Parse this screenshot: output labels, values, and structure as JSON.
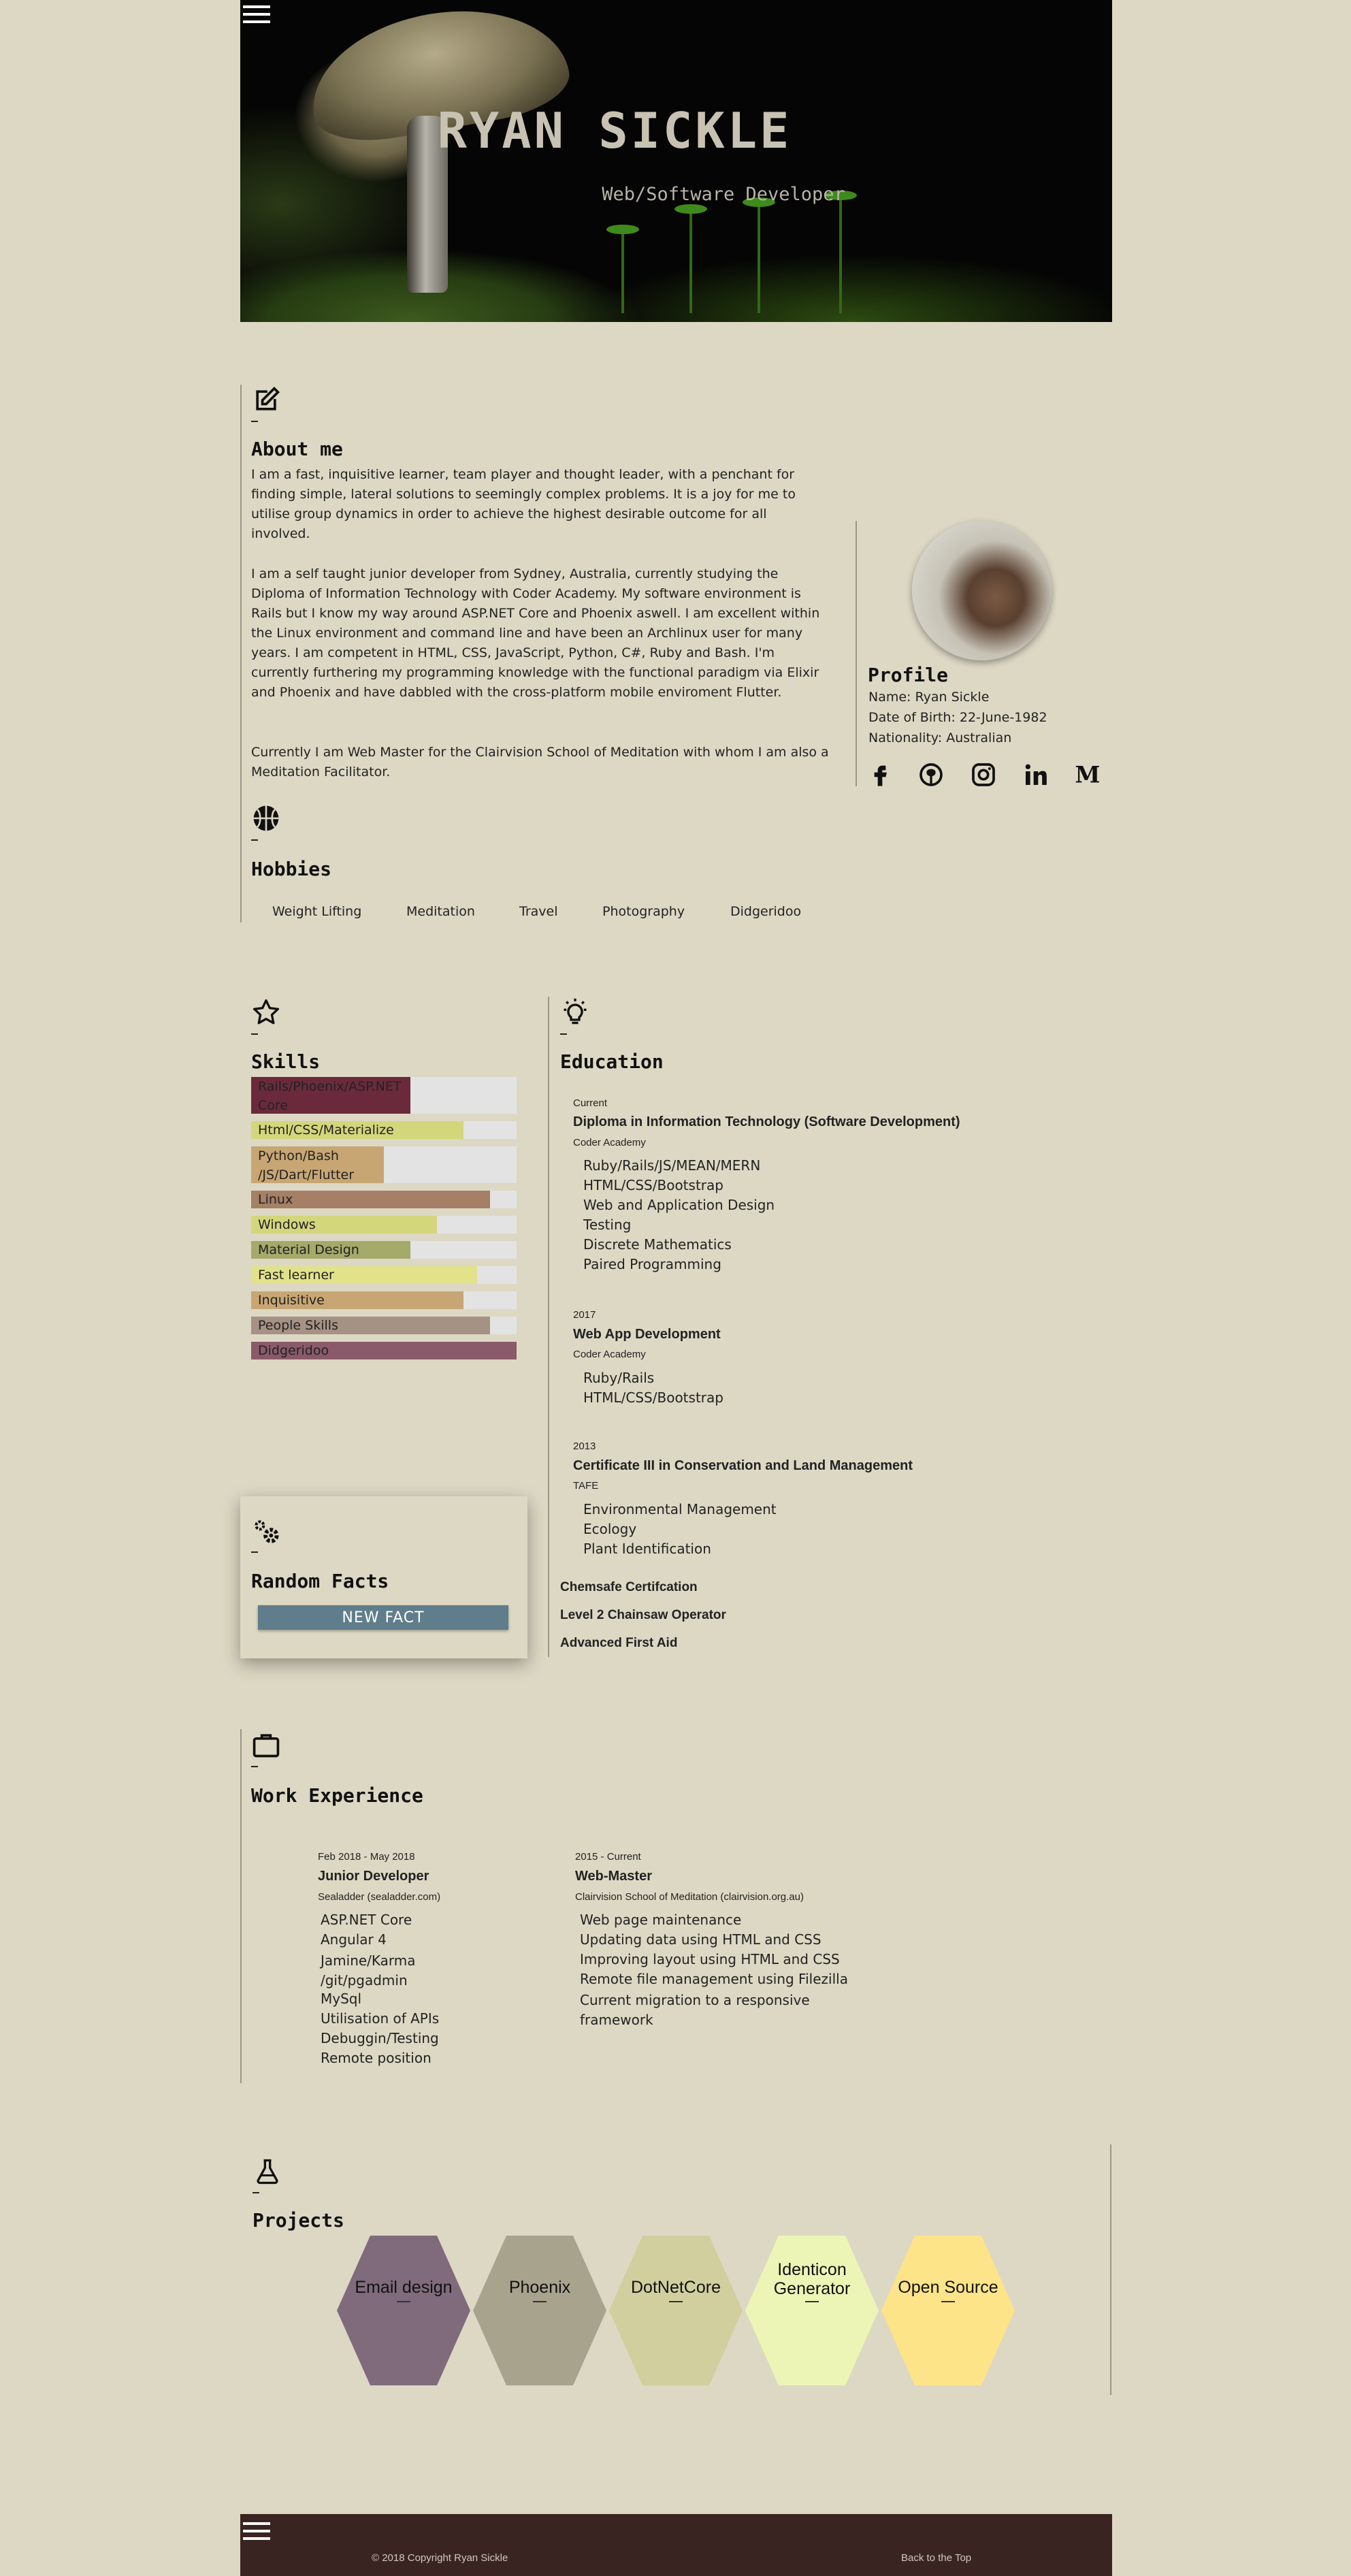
{
  "header": {
    "name": "RYAN SICKLE",
    "subtitle": "Web/Software Developer",
    "menu_icon": "hamburger-menu-icon"
  },
  "about": {
    "icon": "edit-note-icon",
    "title": "About me",
    "paragraphs": [
      "I am a fast, inquisitive learner, team player and thought leader, with a penchant for finding simple, lateral solutions to seemingly complex problems. It is a joy for me to utilise group dynamics in order to achieve the highest desirable outcome for all involved.",
      "I am a self taught junior developer from Sydney, Australia, currently studying the Diploma of Information Technology with Coder Academy. My software environment is Rails but I know my way around ASP.NET Core and Phoenix aswell. I am excellent within the Linux environment and command line and have been an Archlinux user for many years. I am competent in HTML, CSS, JavaScript, Python, C#, Ruby and Bash. I'm currently furthering my programming knowledge with the functional paradigm via Elixir and Phoenix and have dabbled with the cross-platform mobile enviroment Flutter.",
      "Currently I am Web Master for the Clairvision School of Meditation with whom I am also a Meditation Facilitator."
    ]
  },
  "profile": {
    "title": "Profile",
    "name": "Name: Ryan Sickle",
    "dob": "Date of Birth: 22-June-1982",
    "nationality": "Nationality: Australian",
    "social_icons": [
      "facebook-icon",
      "github-icon",
      "instagram-icon",
      "linkedin-icon",
      "medium-icon"
    ]
  },
  "hobbies": {
    "icon": "basketball-icon",
    "title": "Hobbies",
    "items": [
      "Weight Lifting",
      "Meditation",
      "Travel",
      "Photography",
      "Didgeridoo"
    ]
  },
  "skills": {
    "icon": "star-icon",
    "title": "Skills",
    "items": [
      {
        "label": "Rails/Phoenix/ASP.NET Core",
        "level": 0.6,
        "color": "#6b2a3c"
      },
      {
        "label": "Html/CSS/Materialize",
        "level": 0.8,
        "color": "#d4d67c"
      },
      {
        "label": "Python/Bash /JS/Dart/Flutter",
        "level": 0.5,
        "color": "#c8a673"
      },
      {
        "label": "Linux",
        "level": 0.9,
        "color": "#a57f66"
      },
      {
        "label": "Windows",
        "level": 0.7,
        "color": "#d4d67c"
      },
      {
        "label": "Material Design",
        "level": 0.6,
        "color": "#a5a96a"
      },
      {
        "label": "Fast learner",
        "level": 0.85,
        "color": "#e1e28a"
      },
      {
        "label": "Inquisitive",
        "level": 0.8,
        "color": "#c8a673"
      },
      {
        "label": "People Skills",
        "level": 0.9,
        "color": "#a69185"
      },
      {
        "label": "Didgeridoo",
        "level": 1.0,
        "color": "#8a5a6a"
      }
    ]
  },
  "random_facts": {
    "icon": "gears-icon",
    "title": "Random Facts",
    "button": "NEW FACT"
  },
  "education": {
    "icon": "lightbulb-icon",
    "title": "Education",
    "entries": [
      {
        "period": "Current",
        "title": "Diploma in Information Technology (Software Development)",
        "provider": "Coder Academy",
        "items": [
          "Ruby/Rails/JS/MEAN/MERN",
          "HTML/CSS/Bootstrap",
          "Web and Application Design",
          "Testing",
          "Discrete Mathematics",
          "Paired Programming"
        ]
      },
      {
        "period": "2017",
        "title": "Web App Development",
        "provider": "Coder Academy",
        "items": [
          "Ruby/Rails",
          "HTML/CSS/Bootstrap"
        ]
      },
      {
        "period": "2013",
        "title": "Certificate III in Conservation and Land Management",
        "provider": "TAFE",
        "items": [
          "Environmental Management",
          "Ecology",
          "Plant Identification"
        ]
      }
    ],
    "certificates": [
      "Chemsafe Certifcation",
      "Level 2 Chainsaw Operator",
      "Advanced First Aid"
    ]
  },
  "work": {
    "icon": "briefcase-icon",
    "title": "Work Experience",
    "jobs": [
      {
        "period": "Feb 2018 - May 2018",
        "title": "Junior Developer",
        "company": "Sealadder (sealadder.com)",
        "items": [
          "ASP.NET Core",
          "Angular 4",
          "Jamine/Karma /git/pgadmin",
          "MySql",
          "Utilisation of APIs",
          "Debuggin/Testing",
          "Remote position"
        ]
      },
      {
        "period": "2015 - Current",
        "title": "Web-Master",
        "company": "Clairvision School of Meditation (clairvision.org.au)",
        "items": [
          "Web page maintenance",
          "Updating data using HTML and CSS",
          "Improving layout using HTML and CSS",
          "Remote file management using Filezilla",
          "Current migration to a responsive framework"
        ]
      }
    ]
  },
  "projects": {
    "icon": "flask-icon",
    "title": "Projects",
    "items": [
      {
        "label": "Email design",
        "color": "#7f6b7c"
      },
      {
        "label": "Phoenix",
        "color": "#a8a38d"
      },
      {
        "label": "DotNetCore",
        "color": "#d1cf9e"
      },
      {
        "label": "Identicon Generator",
        "color": "#ecf5b5"
      },
      {
        "label": "Open Source",
        "color": "#fde488"
      }
    ]
  },
  "footer": {
    "copyright": "© 2018 Copyright Ryan Sickle",
    "back_to_top": "Back to the Top",
    "menu_icon": "hamburger-menu-icon"
  }
}
